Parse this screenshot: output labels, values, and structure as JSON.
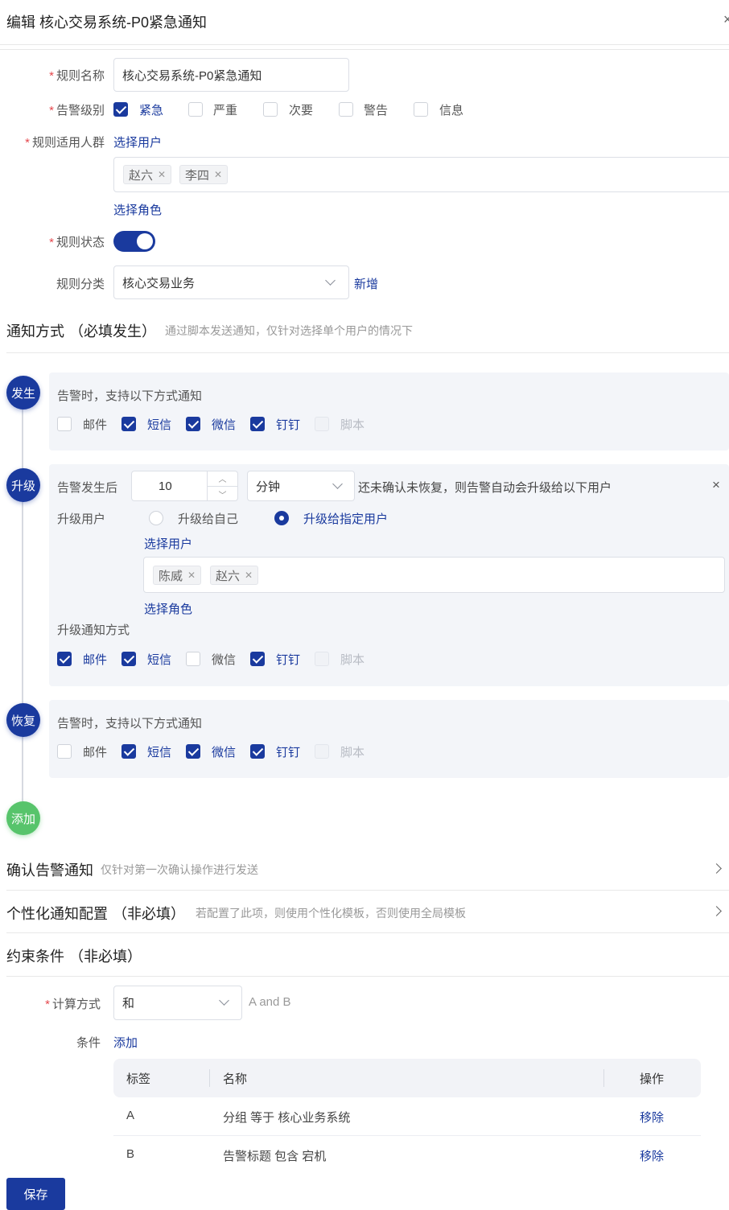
{
  "header": {
    "title": "编辑 核心交易系统-P0紧急通知",
    "close": "×"
  },
  "form": {
    "rule_name": {
      "label": "规则名称",
      "value": "核心交易系统-P0紧急通知"
    },
    "alert_level": {
      "label": "告警级别",
      "options": [
        {
          "label": "紧急",
          "checked": true
        },
        {
          "label": "严重",
          "checked": false
        },
        {
          "label": "次要",
          "checked": false
        },
        {
          "label": "警告",
          "checked": false
        },
        {
          "label": "信息",
          "checked": false
        }
      ]
    },
    "audience": {
      "label": "规则适用人群",
      "select_users": "选择用户",
      "users": [
        "赵六",
        "李四"
      ],
      "select_roles": "选择角色"
    },
    "status": {
      "label": "规则状态",
      "on": true
    },
    "category": {
      "label": "规则分类",
      "value": "核心交易业务",
      "add": "新增"
    }
  },
  "notify": {
    "title": "通知方式",
    "title_suffix": "（必填发生）",
    "hint": "通过脚本发送通知，仅针对选择单个用户的情况下",
    "occur": {
      "badge": "发生",
      "desc": "告警时，支持以下方式通知",
      "channels": [
        "邮件",
        "短信",
        "微信",
        "钉钉",
        "脚本"
      ]
    },
    "escalate": {
      "badge": "升级",
      "prefix": "告警发生后",
      "minutes": "10",
      "unit": "分钟",
      "suffix": "还未确认未恢复，则告警自动会升级给以下用户",
      "close": "×",
      "users_label": "升级用户",
      "radio_self": "升级给自己",
      "radio_specific": "升级给指定用户",
      "select_users": "选择用户",
      "users": [
        "陈威",
        "赵六"
      ],
      "select_roles": "选择角色",
      "channels_label": "升级通知方式",
      "channels": [
        "邮件",
        "短信",
        "微信",
        "钉钉",
        "脚本"
      ]
    },
    "recover": {
      "badge": "恢复",
      "desc": "告警时，支持以下方式通知",
      "channels": [
        "邮件",
        "短信",
        "微信",
        "钉钉",
        "脚本"
      ]
    },
    "add_badge": "添加"
  },
  "confirm": {
    "title": "确认告警通知",
    "hint": "仅针对第一次确认操作进行发送"
  },
  "personal": {
    "title": "个性化通知配置",
    "title_suffix": "（非必填）",
    "hint": "若配置了此项，则使用个性化模板，否则使用全局模板"
  },
  "constraint": {
    "title": "约束条件",
    "title_suffix": "（非必填）",
    "calc_label": "计算方式",
    "calc_value": "和",
    "calc_expr": "A and B",
    "cond_label": "条件",
    "cond_add": "添加",
    "table": {
      "headers": [
        "标签",
        "名称",
        "操作"
      ],
      "rows": [
        {
          "tag": "A",
          "name": "分组 等于 核心业务系统",
          "action": "移除"
        },
        {
          "tag": "B",
          "name": "告警标题 包含 宕机",
          "action": "移除"
        }
      ]
    }
  },
  "save": "保存"
}
